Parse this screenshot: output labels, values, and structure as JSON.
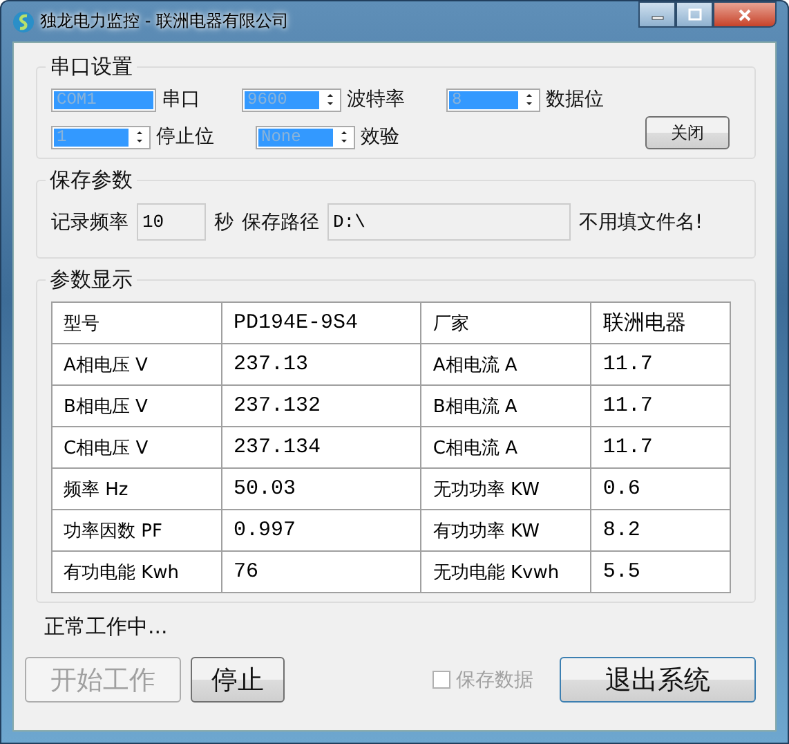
{
  "window": {
    "title": "独龙电力监控 - 联洲电器有限公司"
  },
  "serial_group": {
    "title": "串口设置",
    "rows": [
      [
        {
          "kind": "combo",
          "value": "COM1",
          "suffix": "串口",
          "disabled": true
        },
        {
          "kind": "spinner",
          "value": "9600",
          "suffix": "波特率",
          "disabled": true
        },
        {
          "kind": "spinner",
          "value": "8",
          "suffix": "数据位",
          "disabled": true
        }
      ],
      [
        {
          "kind": "spinner",
          "value": "1",
          "suffix": "停止位",
          "disabled": true
        },
        {
          "kind": "spinner",
          "value": "None",
          "suffix": "效验",
          "disabled": true
        }
      ]
    ],
    "close_button": "关闭"
  },
  "save_group": {
    "title": "保存参数",
    "interval_label": "记录频率",
    "interval": "10",
    "unit": "秒",
    "path_label": "保存路径",
    "path": "D:\\",
    "hint": "不用填文件名!"
  },
  "display_group": {
    "title": "参数显示",
    "rows": [
      [
        "型号",
        "PD194E-9S4",
        "厂家",
        "联洲电器"
      ],
      [
        "A相电压 V",
        "237.13",
        "A相电流 A",
        "11.7"
      ],
      [
        "B相电压 V",
        "237.132",
        "B相电流 A",
        "11.7"
      ],
      [
        "C相电压 V",
        "237.134",
        "C相电流 A",
        "11.7"
      ],
      [
        "频率 Hz",
        "50.03",
        "无功功率 KW",
        "0.6"
      ],
      [
        "功率因数 PF",
        "0.997",
        "有功功率 KW",
        "8.2"
      ],
      [
        "有功电能 Kwh",
        "76",
        "无功电能 Kvwh",
        "5.5"
      ]
    ]
  },
  "status": "正常工作中...",
  "start_button": {
    "label": "开始工作",
    "disabled": true
  },
  "stop_button": {
    "label": "停止",
    "disabled": false
  },
  "save_checkbox": {
    "label": "保存数据",
    "checked": false,
    "disabled": true
  },
  "exit_button": {
    "label": "退出系统",
    "disabled": false
  }
}
